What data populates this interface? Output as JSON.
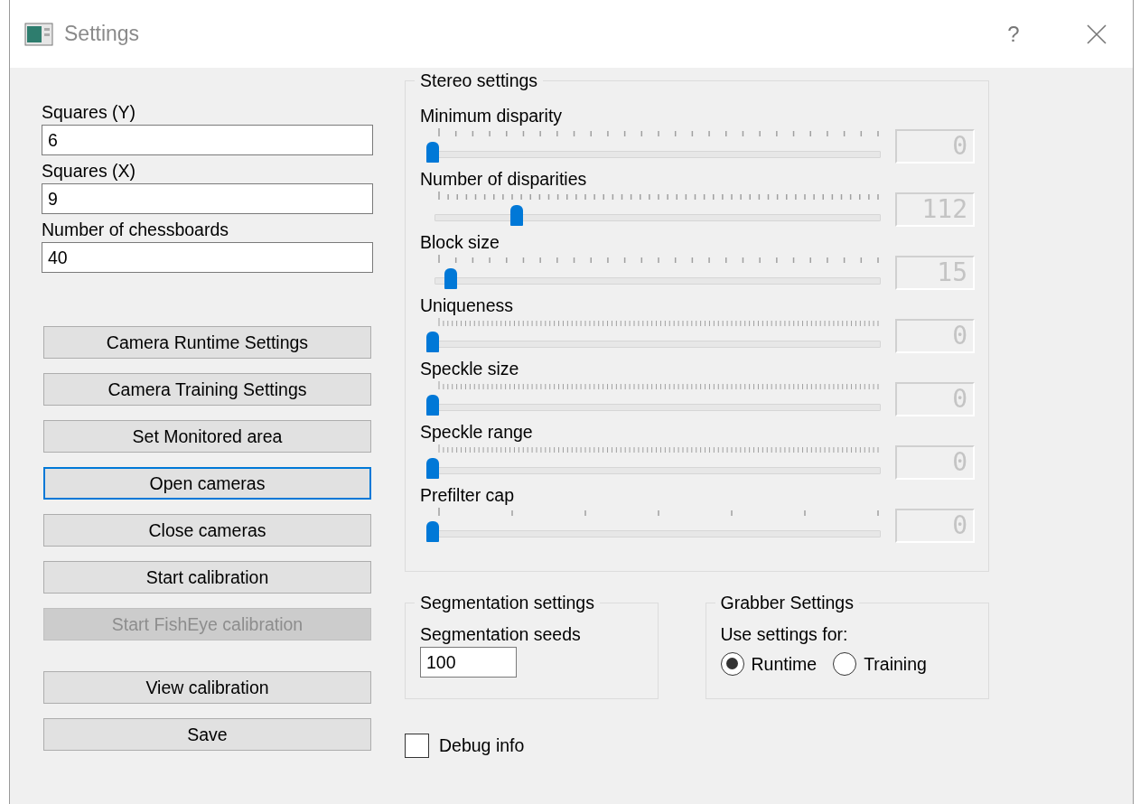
{
  "window": {
    "title": "Settings",
    "help": "?"
  },
  "fields": [
    {
      "label": "Squares (Y)",
      "value": "6"
    },
    {
      "label": "Squares (X)",
      "value": "9"
    },
    {
      "label": "Number of chessboards",
      "value": "40"
    }
  ],
  "buttons": [
    {
      "label": "Camera Runtime Settings",
      "focused": false,
      "disabled": false
    },
    {
      "label": "Camera Training Settings",
      "focused": false,
      "disabled": false
    },
    {
      "label": "Set Monitored area",
      "focused": false,
      "disabled": false
    },
    {
      "label": "Open cameras",
      "focused": true,
      "disabled": false
    },
    {
      "label": "Close cameras",
      "focused": false,
      "disabled": false
    },
    {
      "label": "Start calibration",
      "focused": false,
      "disabled": false
    },
    {
      "label": "Start FishEye calibration",
      "focused": false,
      "disabled": true
    },
    {
      "label": "View calibration",
      "focused": false,
      "disabled": false
    },
    {
      "label": "Save",
      "focused": false,
      "disabled": false
    }
  ],
  "stereo": {
    "title": "Stereo settings",
    "sliders": [
      {
        "label": "Minimum disparity",
        "level": 0,
        "reading": "0"
      },
      {
        "label": "Number of disparities",
        "level": 0.19,
        "reading": "112"
      },
      {
        "label": "Block size",
        "level": 0.04,
        "reading": "15"
      },
      {
        "label": "Uniqueness",
        "level": 0,
        "reading": "0"
      },
      {
        "label": "Speckle size",
        "level": 0,
        "reading": "0"
      },
      {
        "label": "Speckle range",
        "level": 0,
        "reading": "0"
      },
      {
        "label": "Prefilter cap",
        "level": 0,
        "reading": "0"
      }
    ]
  },
  "segmentation": {
    "title": "Segmentation settings",
    "label": "Segmentation seeds",
    "value": "100"
  },
  "grabber": {
    "title": "Grabber Settings",
    "label": "Use settings for:",
    "options": [
      {
        "label": "Runtime",
        "selected": true
      },
      {
        "label": "Training",
        "selected": false
      }
    ]
  },
  "debug": {
    "label": "Debug info",
    "checked": false
  }
}
